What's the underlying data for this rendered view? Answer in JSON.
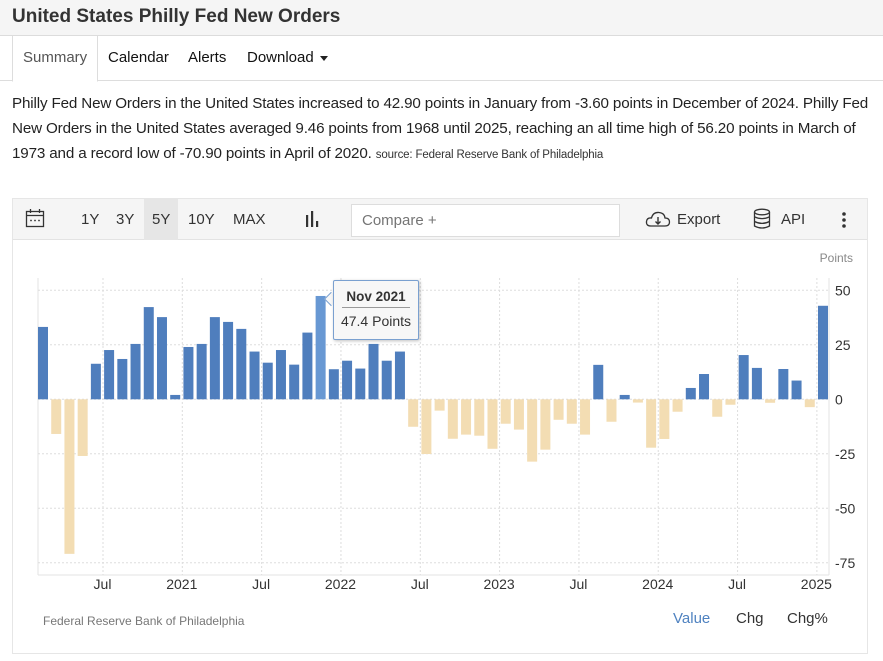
{
  "header": {
    "title": "United States Philly Fed New Orders"
  },
  "tabs": [
    {
      "label": "Summary",
      "active": true
    },
    {
      "label": "Calendar"
    },
    {
      "label": "Alerts"
    },
    {
      "label": "Download"
    }
  ],
  "summary": {
    "text": "Philly Fed New Orders in the United States increased to 42.90 points in January from -3.60 points in December of 2024. Philly Fed New Orders in the United States averaged 9.46 points from 1968 until 2025, reaching an all time high of 56.20 points in March of 1973 and a record low of -70.90 points in April of 2020.",
    "source": "source: Federal Reserve Bank of Philadelphia"
  },
  "toolbar": {
    "ranges": [
      "1Y",
      "3Y",
      "5Y",
      "10Y",
      "MAX"
    ],
    "active_range": "5Y",
    "compare_placeholder": "Compare +",
    "export_label": "Export",
    "api_label": "API"
  },
  "footer": {
    "source": "Federal Reserve Bank of Philadelphia",
    "modes": [
      "Value",
      "Chg",
      "Chg%"
    ],
    "active_mode": "Value"
  },
  "tooltip": {
    "date": "Nov 2021",
    "value": "47.4 Points"
  },
  "colors": {
    "positive": "#4f7ebd",
    "negative": "#f3ddb3",
    "highlight": "#6898d3",
    "active_mode": "#4f82c0"
  },
  "chart_data": {
    "type": "bar",
    "title": "United States Philly Fed New Orders",
    "ylabel": "Points",
    "ylim": [
      -80,
      55
    ],
    "yticks": [
      50,
      25,
      0,
      -25,
      -50,
      -75
    ],
    "grid": true,
    "xtick_labels": [
      {
        "label": "Jul",
        "index": 5
      },
      {
        "label": "2021",
        "index": 11
      },
      {
        "label": "Jul",
        "index": 17
      },
      {
        "label": "2022",
        "index": 23
      },
      {
        "label": "Jul",
        "index": 29
      },
      {
        "label": "2023",
        "index": 35
      },
      {
        "label": "Jul",
        "index": 41
      },
      {
        "label": "2024",
        "index": 47
      },
      {
        "label": "Jul",
        "index": 53
      },
      {
        "label": "2025",
        "index": 59
      }
    ],
    "categories": [
      "Feb 2020",
      "Mar 2020",
      "Apr 2020",
      "May 2020",
      "Jun 2020",
      "Jul 2020",
      "Aug 2020",
      "Sep 2020",
      "Oct 2020",
      "Nov 2020",
      "Dec 2020",
      "Jan 2021",
      "Feb 2021",
      "Mar 2021",
      "Apr 2021",
      "May 2021",
      "Jun 2021",
      "Jul 2021",
      "Aug 2021",
      "Sep 2021",
      "Oct 2021",
      "Nov 2021",
      "Dec 2021",
      "Jan 2022",
      "Feb 2022",
      "Mar 2022",
      "Apr 2022",
      "May 2022",
      "Jun 2022",
      "Jul 2022",
      "Aug 2022",
      "Sep 2022",
      "Oct 2022",
      "Nov 2022",
      "Dec 2022",
      "Jan 2023",
      "Feb 2023",
      "Mar 2023",
      "Apr 2023",
      "May 2023",
      "Jun 2023",
      "Jul 2023",
      "Aug 2023",
      "Sep 2023",
      "Oct 2023",
      "Nov 2023",
      "Dec 2023",
      "Jan 2024",
      "Feb 2024",
      "Mar 2024",
      "Apr 2024",
      "May 2024",
      "Jun 2024",
      "Jul 2024",
      "Aug 2024",
      "Sep 2024",
      "Oct 2024",
      "Nov 2024",
      "Dec 2024",
      "Jan 2025"
    ],
    "values": [
      33.2,
      -15.9,
      -70.9,
      -26.0,
      16.3,
      22.6,
      18.5,
      25.4,
      42.3,
      37.7,
      2.0,
      24.0,
      25.4,
      37.7,
      35.5,
      32.3,
      21.9,
      16.8,
      22.6,
      15.9,
      30.6,
      47.4,
      13.8,
      17.7,
      14.1,
      25.4,
      17.7,
      21.9,
      -12.6,
      -25.1,
      -5.2,
      -18.1,
      -16.2,
      -16.7,
      -22.7,
      -11.2,
      -13.9,
      -28.6,
      -23.1,
      -9.4,
      -11.2,
      -16.2,
      15.8,
      -10.3,
      2.0,
      -1.5,
      -22.2,
      -18.2,
      -5.7,
      5.2,
      11.6,
      -8.0,
      -2.5,
      20.3,
      14.4,
      -1.6,
      13.9,
      8.6,
      -3.6,
      42.9
    ],
    "highlighted": "Nov 2021",
    "source": "Federal Reserve Bank of Philadelphia"
  }
}
